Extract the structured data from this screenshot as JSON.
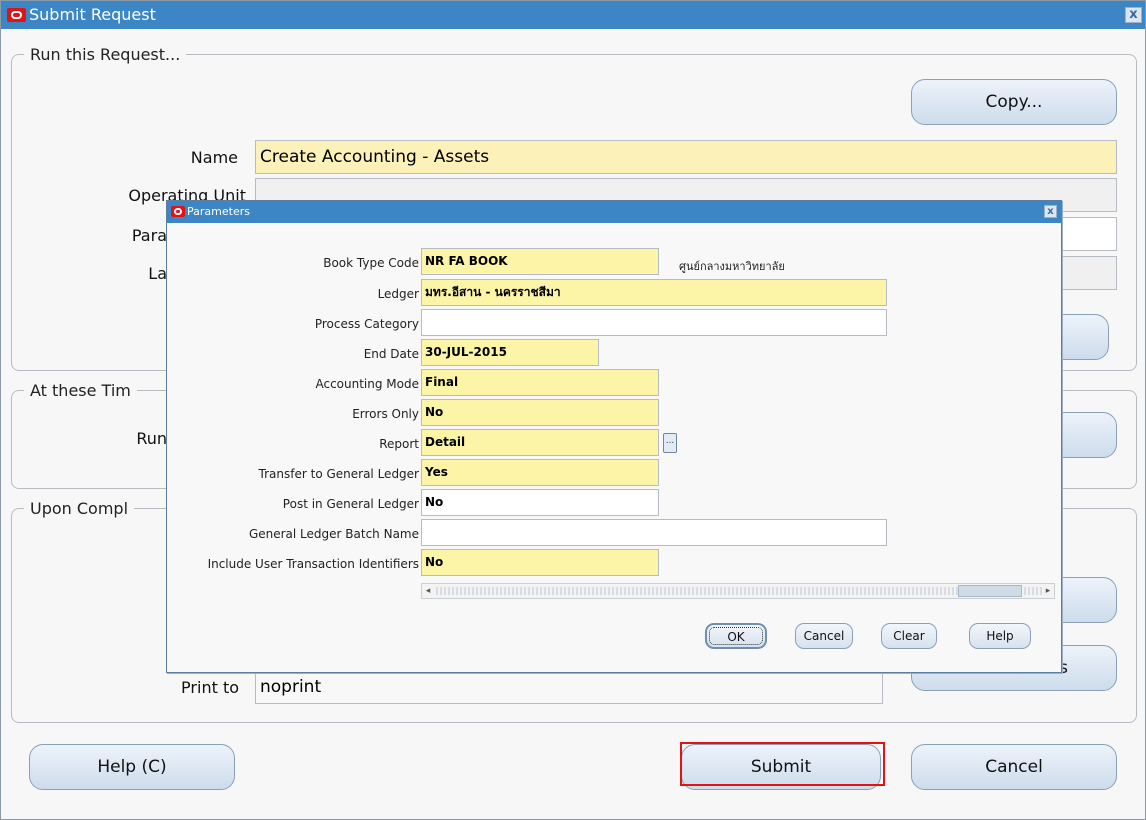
{
  "window": {
    "title": "Submit Request",
    "close_glyph": "x"
  },
  "run_request": {
    "legend": "Run this Request...",
    "copy_label": "Copy...",
    "name_label": "Name",
    "name_value": "Create Accounting - Assets",
    "operating_unit_label": "Operating Unit",
    "parameters_label": "Para",
    "language_label": "La"
  },
  "schedule": {
    "legend": "At these Tim",
    "run_label": "Run"
  },
  "completion": {
    "legend": "Upon Compl",
    "print_to_label": "Print to",
    "print_to_value": "noprint",
    "options_label_fragment": "s"
  },
  "buttons": {
    "help": "Help (C)",
    "submit": "Submit",
    "cancel": "Cancel"
  },
  "parameters_dialog": {
    "title": "Parameters",
    "rows": [
      {
        "label": "Book Type Code",
        "value": "NR FA BOOK",
        "required": true,
        "description": "ศูนย์กลางมหาวิทยาลัย"
      },
      {
        "label": "Ledger",
        "value": "มทร.อีสาน - นครราชสีมา",
        "required": true
      },
      {
        "label": "Process Category",
        "value": "",
        "required": false
      },
      {
        "label": "End Date",
        "value": "30-JUL-2015",
        "required": true
      },
      {
        "label": "Accounting Mode",
        "value": "Final",
        "required": true
      },
      {
        "label": "Errors Only",
        "value": "No",
        "required": true
      },
      {
        "label": "Report",
        "value": "Detail",
        "required": true
      },
      {
        "label": "Transfer to General Ledger",
        "value": "Yes",
        "required": true
      },
      {
        "label": "Post in General Ledger",
        "value": "No",
        "required": false
      },
      {
        "label": "General Ledger Batch Name",
        "value": "",
        "required": false
      },
      {
        "label": "Include User Transaction Identifiers",
        "value": "No",
        "required": true
      }
    ],
    "lov_glyph": "...",
    "buttons": {
      "ok": "OK",
      "cancel": "Cancel",
      "clear": "Clear",
      "help": "Help"
    }
  },
  "colors": {
    "title_bar": "#3d86c6",
    "required_field": "#fcf1b8",
    "highlight": "#e01414"
  }
}
